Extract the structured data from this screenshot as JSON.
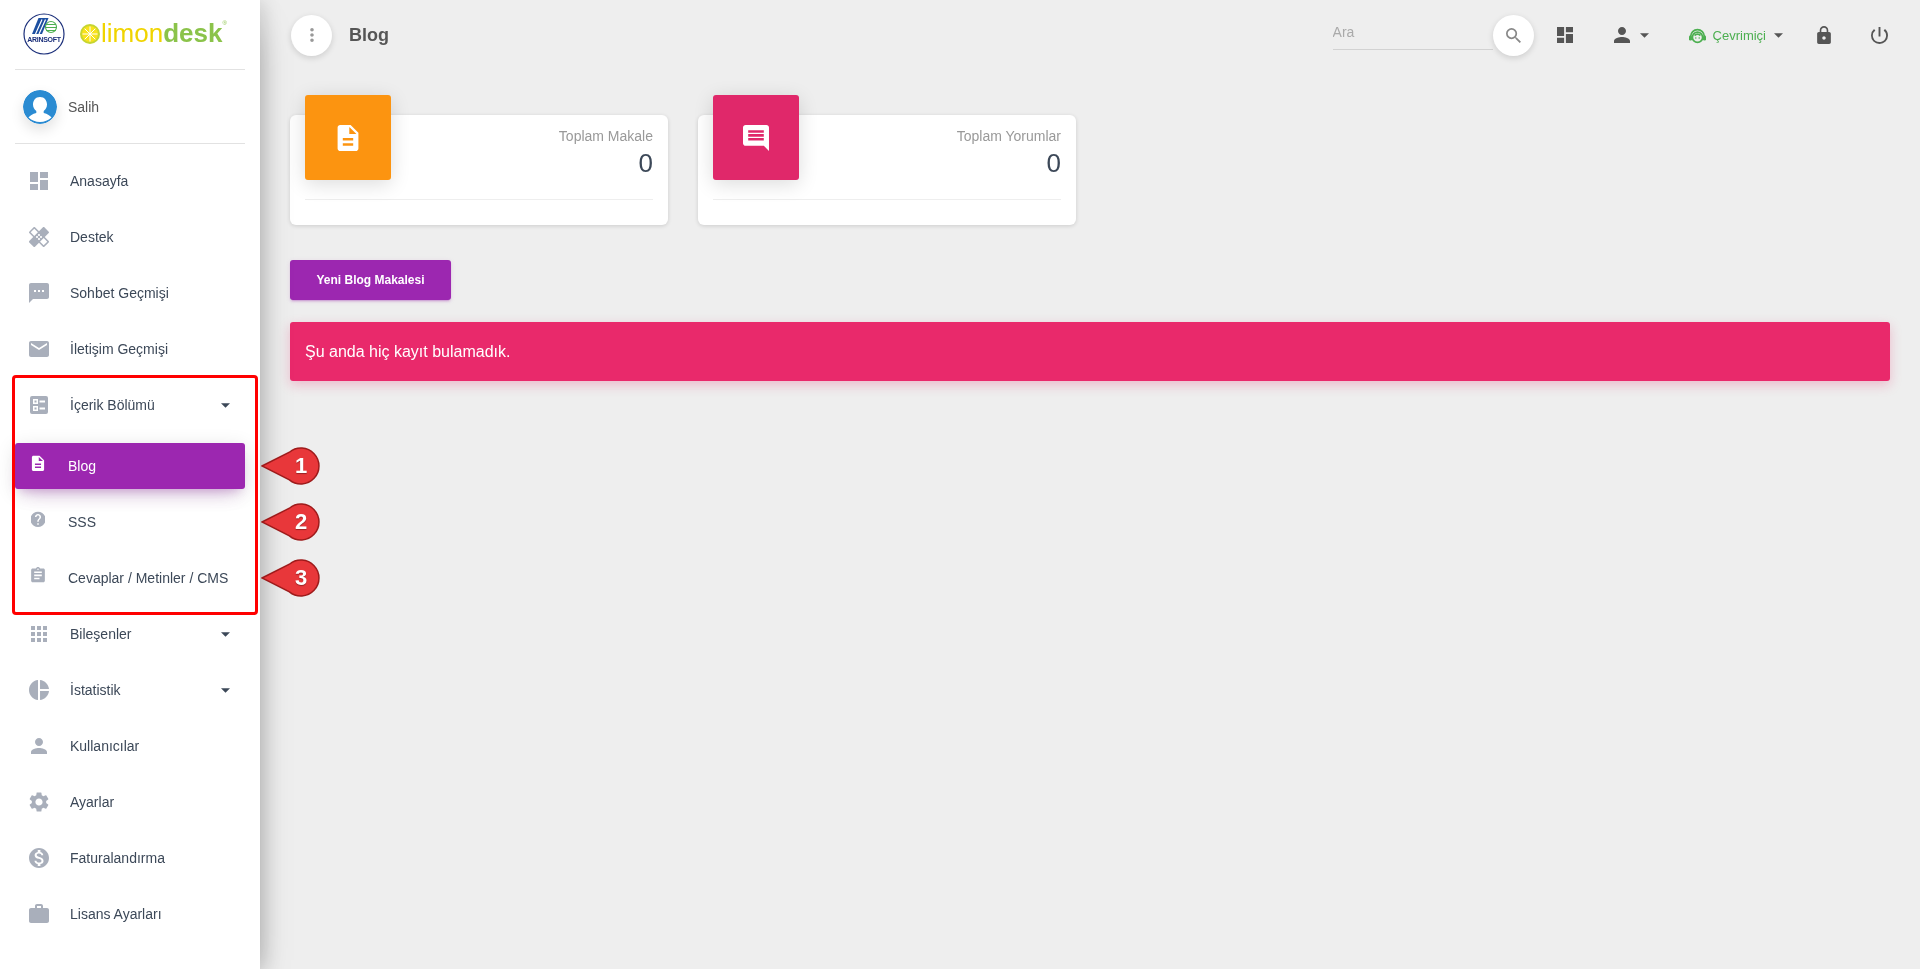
{
  "logo": {
    "emblem_caption": "ARINSOFT",
    "product": "limon**desk**$^{®}$"
  },
  "user": {
    "name": "Salih"
  },
  "menu": [
    {
      "label": "Anasayfa",
      "has_submenu": false,
      "selected": false
    },
    {
      "label": "Destek",
      "has_submenu": false,
      "selected": false
    },
    {
      "label": "Sohbet Geçmişi",
      "has_submenu": false,
      "selected": false
    },
    {
      "label": "İletişim Geçmişi",
      "has_submenu": false,
      "selected": false
    },
    {
      "label": "İçerik Bölümü",
      "has_submenu": true,
      "selected": false,
      "annotation_frame": true,
      "children": [
        {
          "label": "Blog",
          "selected": true,
          "callout": "1"
        },
        {
          "label": "SSS",
          "selected": false,
          "callout": "2"
        },
        {
          "label": "Cevaplar / Metinler / CMS",
          "selected": false,
          "callout": "3"
        }
      ]
    },
    {
      "label": "Bileşenler",
      "has_submenu": true,
      "selected": false
    },
    {
      "label": "İstatistik",
      "has_submenu": true,
      "selected": false
    },
    {
      "label": "Kullanıcılar",
      "has_submenu": false,
      "selected": false
    },
    {
      "label": "Ayarlar",
      "has_submenu": false,
      "selected": false
    },
    {
      "label": "Faturalandırma",
      "has_submenu": false,
      "selected": false
    },
    {
      "label": "Lisans Ayarları",
      "has_submenu": false,
      "selected": false
    }
  ],
  "topbar": {
    "title": "Blog",
    "search": {
      "placeholder": "Ara"
    },
    "status": {
      "label": "Çevrimiçi"
    }
  },
  "stats": [
    {
      "label": "Toplam Makale",
      "value": "0",
      "color": "#fc9410"
    },
    {
      "label": "Toplam Yorumlar",
      "value": "0",
      "color": "#e0286a"
    }
  ],
  "new_button": {
    "label": "Yeni Blog Makalesi"
  },
  "alert": {
    "message": "Şu anda hiç kayıt bulamadık."
  }
}
